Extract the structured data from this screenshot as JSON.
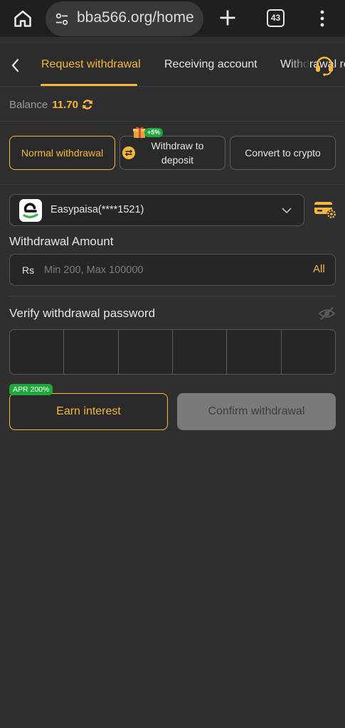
{
  "browser": {
    "url": "bba566.org/home",
    "tab_count": "43",
    "icons": [
      "home-icon",
      "site-settings-icon",
      "new-tab-icon",
      "tab-switcher-icon",
      "more-vert-icon"
    ]
  },
  "tabs": [
    {
      "label": "Request withdrawal",
      "active": true
    },
    {
      "label": "Receiving account",
      "active": false
    },
    {
      "label": "Withdrawal record",
      "active": false
    }
  ],
  "balance": {
    "label": "Balance",
    "value": "11.70"
  },
  "methods": [
    {
      "label": "Normal withdrawal",
      "active": true
    },
    {
      "label": "Withdraw to deposit",
      "badge": "+5%"
    },
    {
      "label": "Convert to crypto"
    }
  ],
  "account": {
    "name": "Easypaisa(****1521)"
  },
  "amount": {
    "label": "Withdrawal Amount",
    "currency": "Rs",
    "placeholder": "Min 200, Max 100000",
    "all_label": "All"
  },
  "password": {
    "label": "Verify withdrawal password",
    "cells": 6
  },
  "actions": {
    "apr_badge": "APR 200%",
    "earn_label": "Earn interest",
    "confirm_label": "Confirm withdrawal"
  },
  "colors": {
    "accent": "#f6b73c",
    "background": "#2f2f2f",
    "badge_green": "#1fa83a",
    "disabled": "#7a7a7a"
  }
}
